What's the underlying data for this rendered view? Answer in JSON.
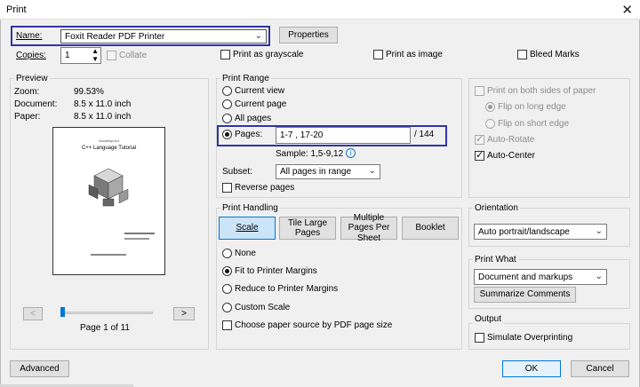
{
  "window": {
    "title": "Print",
    "close_glyph": "✕"
  },
  "printer": {
    "name_label": "Name:",
    "name_value": "Foxit Reader PDF Printer",
    "properties_label": "Properties"
  },
  "copies": {
    "label": "Copies:",
    "value": "1",
    "collate_label": "Collate"
  },
  "options": {
    "grayscale_label": "Print as grayscale",
    "as_image_label": "Print as image",
    "bleed_label": "Bleed Marks"
  },
  "preview": {
    "title": "Preview",
    "zoom_label": "Zoom:",
    "zoom_value": "99.53%",
    "document_label": "Document:",
    "document_value": "8.5 x 11.0 inch",
    "paper_label": "Paper:",
    "paper_value": "8.5 x 11.0 inch",
    "page_small_text": "tutorialspoint",
    "page_heading": "C++ Language Tutorial",
    "prev_glyph": "<",
    "next_glyph": ">",
    "page_counter": "Page 1 of 11",
    "slider_fraction": 0.0
  },
  "print_range": {
    "title": "Print Range",
    "current_view": "Current view",
    "current_page": "Current page",
    "all_pages": "All pages",
    "pages_label": "Pages:",
    "pages_value": "1-7 , 17-20",
    "total": "/ 144",
    "sample": "Sample: 1,5-9,12",
    "subset_label": "Subset:",
    "subset_value": "All pages in range",
    "reverse_label": "Reverse pages"
  },
  "duplex": {
    "both_sides": "Print on both sides of paper",
    "flip_long": "Flip on long edge",
    "flip_short": "Flip on short edge",
    "auto_rotate": "Auto-Rotate",
    "auto_center": "Auto-Center"
  },
  "print_handling": {
    "title": "Print Handling",
    "tabs": [
      "Scale",
      "Tile Large Pages",
      "Multiple Pages Per Sheet",
      "Booklet"
    ],
    "none": "None",
    "fit": "Fit to Printer Margins",
    "reduce": "Reduce to Printer Margins",
    "custom": "Custom Scale",
    "paper_source": "Choose paper source by PDF page size"
  },
  "orientation": {
    "title": "Orientation",
    "value": "Auto portrait/landscape"
  },
  "print_what": {
    "title": "Print What",
    "value": "Document and markups",
    "summarize_label": "Summarize Comments"
  },
  "output": {
    "title": "Output",
    "simulate_label": "Simulate Overprinting"
  },
  "footer": {
    "advanced_label": "Advanced",
    "ok_label": "OK",
    "cancel_label": "Cancel"
  },
  "colors": {
    "highlight": "#3333a6",
    "info": "#1a73c8"
  }
}
